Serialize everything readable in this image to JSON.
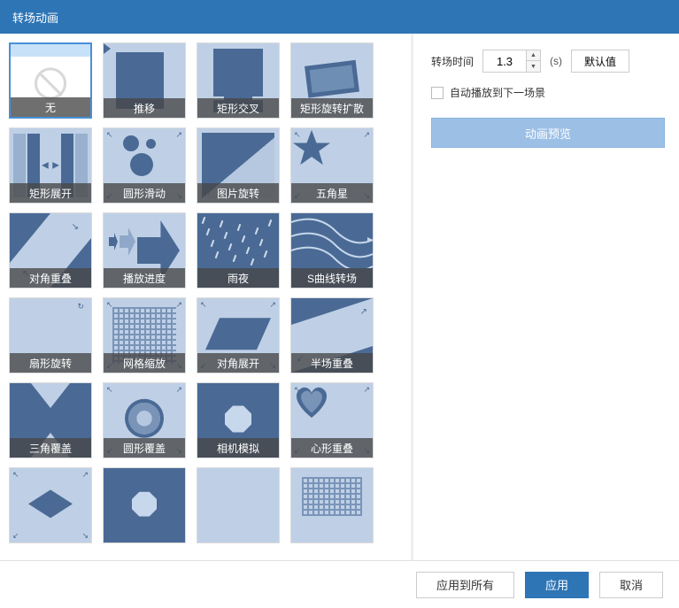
{
  "title": "转场动画",
  "transitions": [
    {
      "id": "none",
      "label": "无",
      "selected": true
    },
    {
      "id": "push",
      "label": "推移"
    },
    {
      "id": "rectcross",
      "label": "矩形交叉"
    },
    {
      "id": "rotate",
      "label": "矩形旋转扩散"
    },
    {
      "id": "expand",
      "label": "矩形展开"
    },
    {
      "id": "circle-slide",
      "label": "圆形滑动"
    },
    {
      "id": "pic-rotate",
      "label": "图片旋转"
    },
    {
      "id": "star",
      "label": "五角星"
    },
    {
      "id": "diag",
      "label": "对角重叠"
    },
    {
      "id": "progress",
      "label": "播放进度"
    },
    {
      "id": "rain",
      "label": "雨夜"
    },
    {
      "id": "scurve",
      "label": "S曲线转场"
    },
    {
      "id": "fan",
      "label": "扇形旋转"
    },
    {
      "id": "gridzoom",
      "label": "网格缩放"
    },
    {
      "id": "diag-expand",
      "label": "对角展开"
    },
    {
      "id": "half",
      "label": "半场重叠"
    },
    {
      "id": "tri-cover",
      "label": "三角覆盖"
    },
    {
      "id": "circ-cover",
      "label": "圆形覆盖"
    },
    {
      "id": "camera",
      "label": "相机模拟"
    },
    {
      "id": "heart",
      "label": "心形重叠"
    },
    {
      "id": "p1",
      "label": ""
    },
    {
      "id": "p2",
      "label": ""
    },
    {
      "id": "p3",
      "label": ""
    },
    {
      "id": "p4",
      "label": ""
    }
  ],
  "settings": {
    "duration_label": "转场时间",
    "duration_value": "1.3",
    "duration_unit": "(s)",
    "default_button": "默认值",
    "autoplay_label": "自动播放到下一场景",
    "autoplay_checked": false,
    "preview_button": "动画预览"
  },
  "footer": {
    "apply_all": "应用到所有",
    "apply": "应用",
    "cancel": "取消"
  }
}
